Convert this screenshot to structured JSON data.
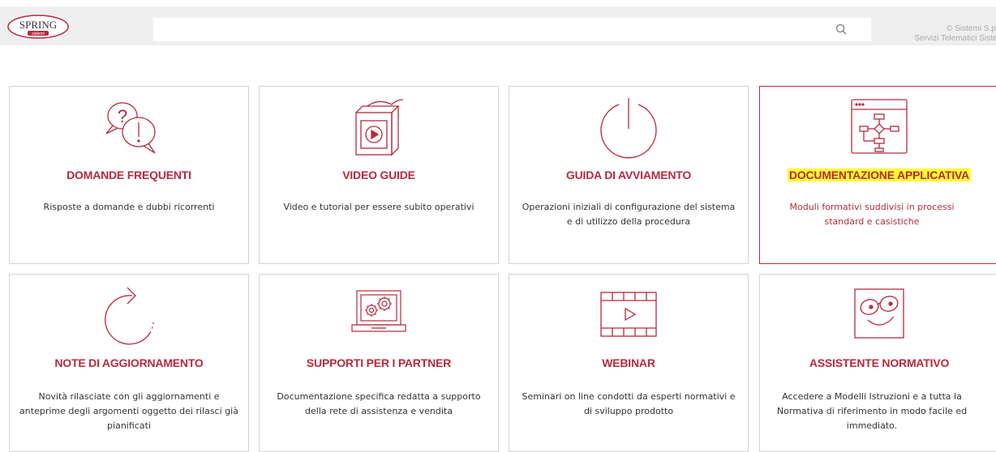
{
  "header": {
    "logo_text": "SPRING",
    "logo_sub": "sistemi",
    "search_placeholder": "",
    "search_icon": "search-icon",
    "copyright_line1": "© Sistemi S.p.A.",
    "copyright_line2": "Servizi Telematici Sistemi"
  },
  "colors": {
    "accent": "#b52a3e",
    "highlight": "#ffff33",
    "topbar": "#efefef"
  },
  "cards": [
    {
      "title": "DOMANDE FREQUENTI",
      "desc": "Risposte a domande e dubbi ricorrenti",
      "icon": "question-exclamation-bubbles-icon",
      "active": false
    },
    {
      "title": "VIDEO GUIDE",
      "desc": "Video e tutorial per essere subito operativi",
      "icon": "video-book-icon",
      "active": false
    },
    {
      "title": "GUIDA DI AVVIAMENTO",
      "desc": "Operazioni iniziali di configurazione del sistema e di utilizzo della procedura",
      "icon": "power-icon",
      "active": false
    },
    {
      "title": "DOCUMENTAZIONE APPLICATIVA",
      "desc": "Moduli formativi suddivisi in processi standard e casistiche",
      "icon": "flowchart-window-icon",
      "active": true
    },
    {
      "title": "NOTE DI AGGIORNAMENTO",
      "desc": "Novità rilasciate con gli aggiornamenti e anteprime degli argomenti oggetto dei rilasci già pianificati",
      "icon": "refresh-arrow-icon",
      "active": false
    },
    {
      "title": "SUPPORTI PER I PARTNER",
      "desc": "Documentazione specifica redatta a supporto della rete di assistenza e vendita",
      "icon": "laptop-gears-icon",
      "active": false
    },
    {
      "title": "WEBINAR",
      "desc": "Seminari on line condotti da esperti normativi e di sviluppo prodotto",
      "icon": "film-play-icon",
      "active": false
    },
    {
      "title": "ASSISTENTE NORMATIVO",
      "desc": "Accedere a Modelli Istruzioni e a tutta la Normativa di riferimento in modo facile ed immediato.",
      "icon": "glasses-smile-icon",
      "active": false
    }
  ]
}
